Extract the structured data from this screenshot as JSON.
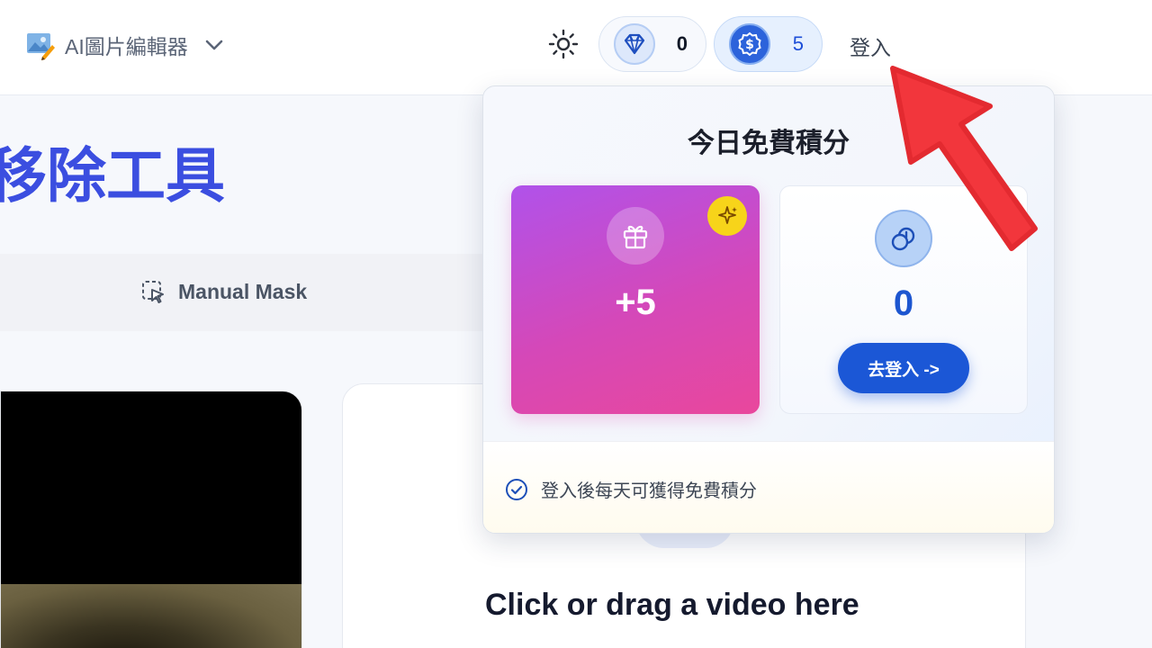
{
  "header": {
    "app_name": "AI圖片編輯器",
    "gems_count": "0",
    "credits_count": "5",
    "login_label": "登入"
  },
  "page": {
    "title": "移除工具",
    "mode_tab_label": "Manual Mask",
    "upload_prompt": "Click or drag a video here"
  },
  "popover": {
    "title": "今日免費積分",
    "gift_card": {
      "amount": "+5"
    },
    "login_card": {
      "amount": "0",
      "button_label": "去登入 ->"
    },
    "footer_note": "登入後每天可獲得免費積分"
  },
  "colors": {
    "accent_blue": "#1b57d6",
    "title_blue": "#3b4ee0",
    "gift_gradient_start": "#b052ea",
    "gift_gradient_end": "#e9479c",
    "arrow_red": "#f2363c",
    "spark_yellow": "#f7d41a"
  }
}
